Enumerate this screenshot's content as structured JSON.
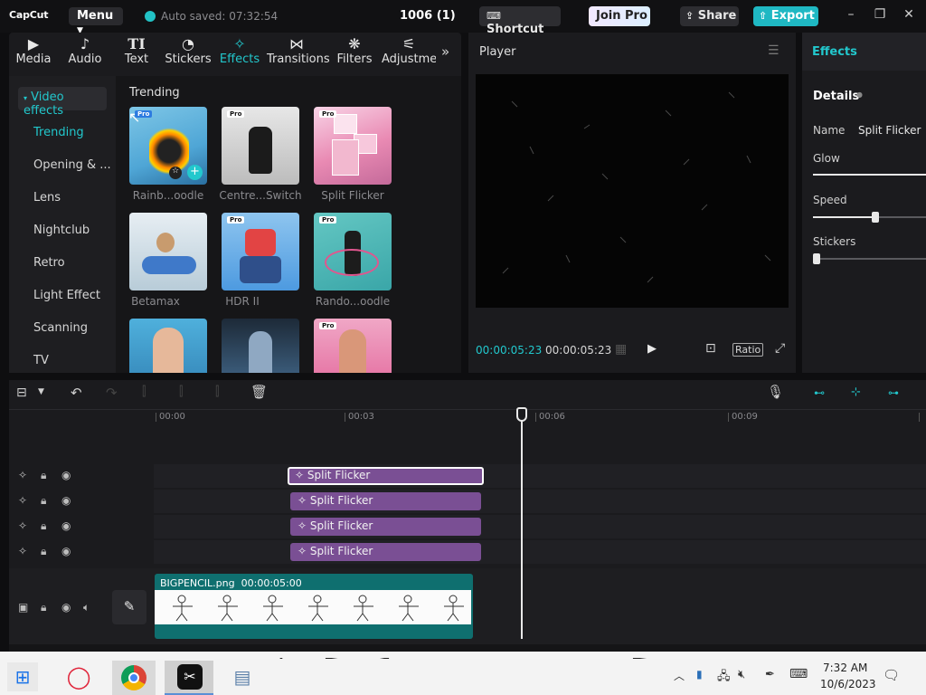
{
  "titlebar": {
    "logo": "CapCut",
    "menu_label": "Menu",
    "autosave": "Auto saved: 07:32:54",
    "project_name": "1006 (1)",
    "shortcut_label": "Shortcut",
    "join_pro_label": "Join Pro",
    "share_label": "Share",
    "export_label": "Export"
  },
  "tabs": [
    {
      "label": "Media",
      "icon": "media-icon"
    },
    {
      "label": "Audio",
      "icon": "audio-icon"
    },
    {
      "label": "Text",
      "icon": "text-icon"
    },
    {
      "label": "Stickers",
      "icon": "stickers-icon"
    },
    {
      "label": "Effects",
      "icon": "effects-icon"
    },
    {
      "label": "Transitions",
      "icon": "transitions-icon"
    },
    {
      "label": "Filters",
      "icon": "filters-icon"
    },
    {
      "label": "Adjustme",
      "icon": "adjustment-icon"
    }
  ],
  "sidebar": {
    "header": "Video effects",
    "items": [
      "Trending",
      "Opening & ...",
      "Lens",
      "Nightclub",
      "Retro",
      "Light Effect",
      "Scanning",
      "TV"
    ]
  },
  "effects": {
    "heading": "Trending",
    "items": [
      {
        "label": "Rainb...oodle",
        "pro": "Pro"
      },
      {
        "label": "Centre...Switch",
        "pro": "Pro"
      },
      {
        "label": "Split Flicker",
        "pro": "Pro"
      },
      {
        "label": "Betamax",
        "pro": ""
      },
      {
        "label": "HDR II",
        "pro": "Pro"
      },
      {
        "label": "Rando...oodle",
        "pro": "Pro"
      },
      {
        "label": "",
        "pro": ""
      },
      {
        "label": "",
        "pro": ""
      },
      {
        "label": "",
        "pro": "Pro"
      }
    ]
  },
  "player": {
    "title": "Player",
    "time_current": "00:00:05:23",
    "time_total": "00:00:05:23",
    "ratio_label": "Ratio"
  },
  "right_panel": {
    "title": "Effects",
    "details_label": "Details",
    "name_label": "Name",
    "name_value": "Split Flicker",
    "params": [
      {
        "label": "Glow"
      },
      {
        "label": "Speed"
      },
      {
        "label": "Stickers"
      }
    ]
  },
  "timeline": {
    "ruler": [
      "00:00",
      "00:03",
      "00:06",
      "00:09"
    ],
    "effect_clips": [
      "Split Flicker",
      "Split Flicker",
      "Split Flicker",
      "Split Flicker"
    ],
    "main_clip": {
      "name": "BIGPENCIL.png",
      "duration": "00:00:05:00"
    }
  },
  "taskbar": {
    "time": "7:32 AM",
    "date": "10/6/2023"
  },
  "colors": {
    "accent": "#22c8cd",
    "clip_purple": "#7a4f94",
    "export": "#1fb8c3"
  }
}
